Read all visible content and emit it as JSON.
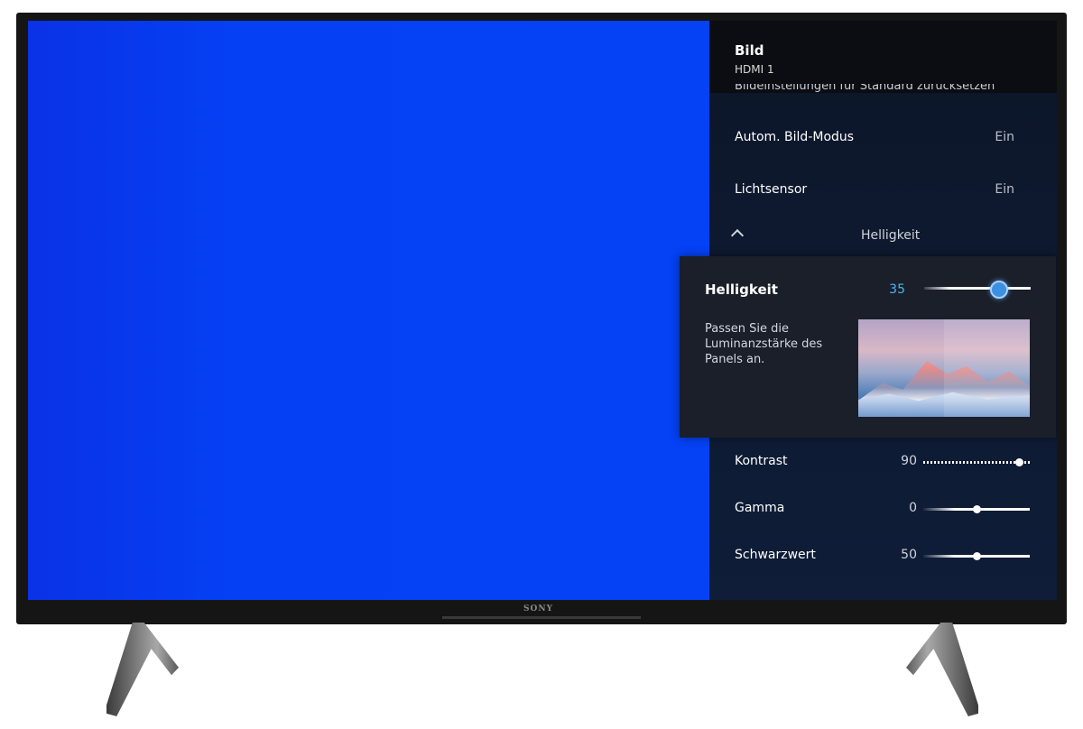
{
  "menu": {
    "title": "Bild",
    "subtitle": "HDMI 1",
    "clipped_row": "Bildeinstellungen für Standard zurücksetzen",
    "rows": [
      {
        "label": "Autom. Bild-Modus",
        "value": "Ein"
      },
      {
        "label": "Lichtsensor",
        "value": "Ein"
      }
    ],
    "section": {
      "label": "Helligkeit"
    },
    "sliders": [
      {
        "label": "Kontrast",
        "value": "90",
        "level": 0.9
      },
      {
        "label": "Gamma",
        "value": "0",
        "level": 0.5
      },
      {
        "label": "Schwarzwert",
        "value": "50",
        "level": 0.5
      }
    ]
  },
  "popup": {
    "title": "Helligkeit",
    "value": "35",
    "level": 0.7,
    "description": "Passen Sie die Luminanzstärke des Panels an."
  },
  "bezel": {
    "logo": "SONY"
  },
  "colors": {
    "screen_blue": "#0542f6",
    "accent": "#4fb3f2",
    "panel_bg": "#0e1a33"
  }
}
